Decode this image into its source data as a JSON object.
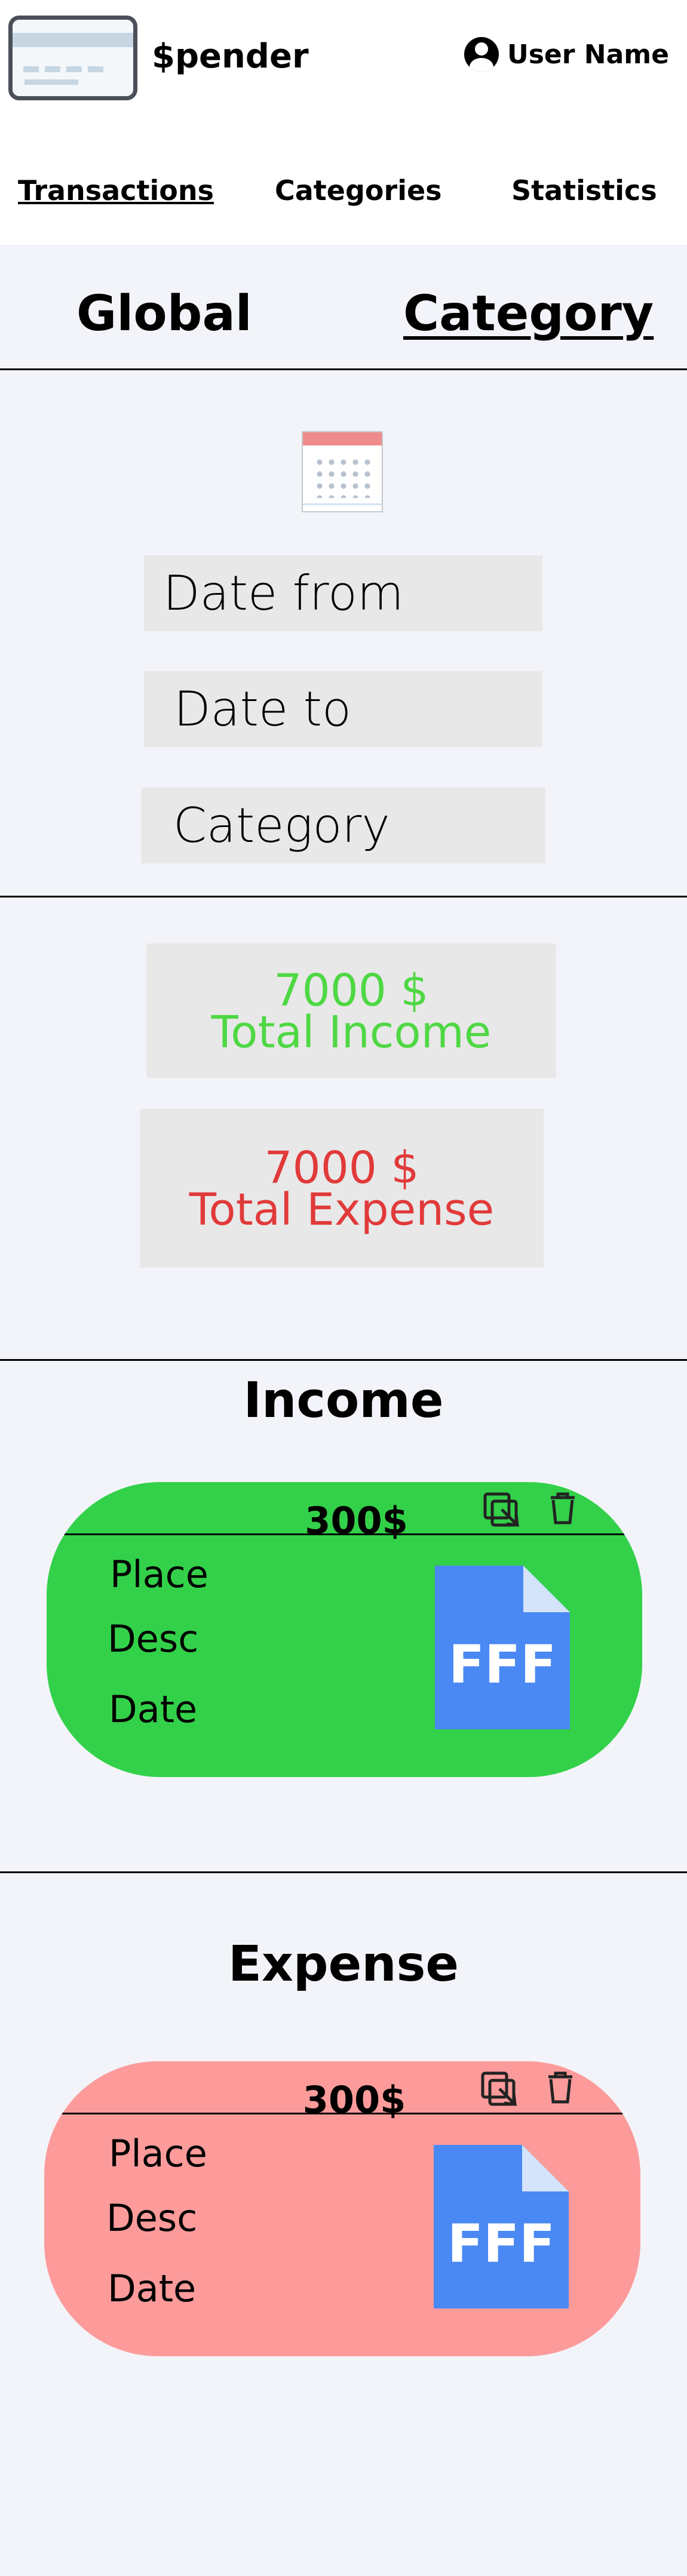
{
  "app": {
    "name": "$pender"
  },
  "user": {
    "name": "User Name"
  },
  "nav": {
    "transactions": "Transactions",
    "categories": "Categories",
    "statistics": "Statistics"
  },
  "scope": {
    "global": "Global",
    "category": "Category",
    "active": "category"
  },
  "filters": {
    "date_from": "Date from",
    "date_to": "Date to",
    "category": "Category"
  },
  "summary": {
    "income_amount": "7000 $",
    "income_label": "Total Income",
    "expense_amount": "7000 $",
    "expense_label": "Total Expense",
    "income_color": "#4ed843",
    "expense_color": "#e13a3a"
  },
  "income": {
    "title": "Income",
    "card": {
      "amount": "300$",
      "place": "Place",
      "desc": "Desc",
      "date": "Date",
      "file_label": "FFF",
      "color": "#33d14a"
    }
  },
  "expense": {
    "title": "Expense",
    "card": {
      "amount": "300$",
      "place": "Place",
      "desc": "Desc",
      "date": "Date",
      "file_label": "FFF",
      "color": "#fd9b9b"
    }
  },
  "icons": [
    "calendar-icon",
    "copy-icon",
    "trash-icon",
    "file-icon",
    "user-avatar-icon",
    "app-logo-card-icon"
  ]
}
